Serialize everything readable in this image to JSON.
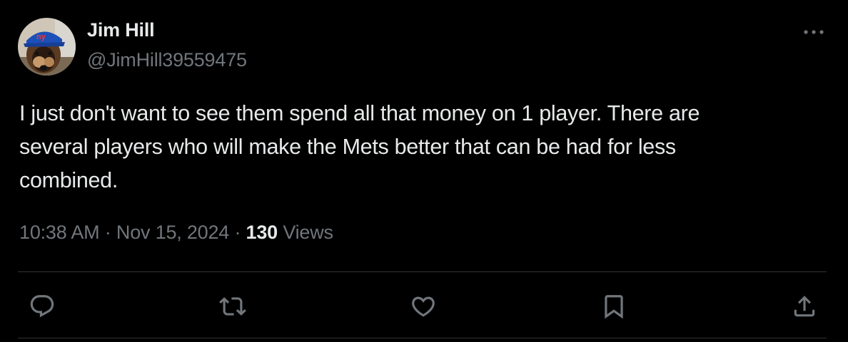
{
  "author": {
    "display_name": "Jim Hill",
    "handle": "@JimHill39559475",
    "avatar_icon": "dog-with-ny-cap-avatar"
  },
  "tweet": {
    "text": "I just don't want to see them spend all that money on 1 player. There are\nseveral players who will make the Mets better that can be had for less\ncombined."
  },
  "meta": {
    "time": "10:38 AM",
    "separator": "·",
    "date": "Nov 15, 2024",
    "views_count": "130",
    "views_label": "Views"
  },
  "actions": [
    {
      "name": "reply",
      "icon": "reply-icon"
    },
    {
      "name": "retweet",
      "icon": "retweet-icon"
    },
    {
      "name": "like",
      "icon": "heart-icon"
    },
    {
      "name": "bookmark",
      "icon": "bookmark-icon"
    },
    {
      "name": "share",
      "icon": "share-icon"
    }
  ],
  "colors": {
    "background": "#000000",
    "primary_text": "#e7e9ea",
    "secondary_text": "#71767b",
    "divider": "#2f3336",
    "icon": "#71767b"
  }
}
